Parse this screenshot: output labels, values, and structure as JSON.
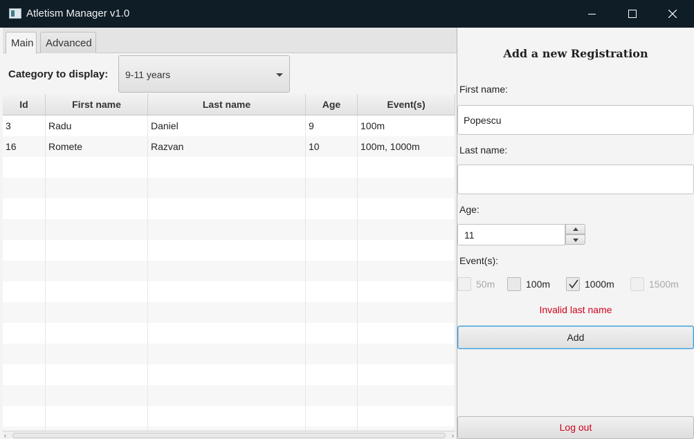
{
  "window": {
    "title": "Atletism Manager v1.0"
  },
  "tabs": [
    {
      "label": "Main",
      "active": true
    },
    {
      "label": "Advanced",
      "active": false
    }
  ],
  "category": {
    "label": "Category to display:",
    "selected": "9-11 years"
  },
  "table": {
    "columns": [
      "Id",
      "First name",
      "Last name",
      "Age",
      "Event(s)"
    ],
    "rows": [
      {
        "id": "3",
        "first_name": "Radu",
        "last_name": "Daniel",
        "age": "9",
        "events": "100m"
      },
      {
        "id": "16",
        "first_name": "Romete",
        "last_name": "Razvan",
        "age": "10",
        "events": "100m, 1000m"
      }
    ]
  },
  "form": {
    "title": "Add a new Registration",
    "first_name_label": "First name:",
    "first_name_value": "Popescu",
    "last_name_label": "Last name:",
    "last_name_value": "",
    "age_label": "Age:",
    "age_value": "11",
    "events_label": "Event(s):",
    "events": [
      {
        "label": "50m",
        "checked": false,
        "disabled": true
      },
      {
        "label": "100m",
        "checked": false,
        "disabled": false
      },
      {
        "label": "1000m",
        "checked": true,
        "disabled": false
      },
      {
        "label": "1500m",
        "checked": false,
        "disabled": true
      }
    ],
    "error": "Invalid last name",
    "add_label": "Add",
    "logout_label": "Log out"
  },
  "colors": {
    "titlebar": "#0f1d26",
    "error": "#d0021b",
    "focus": "#3b9ad8"
  }
}
